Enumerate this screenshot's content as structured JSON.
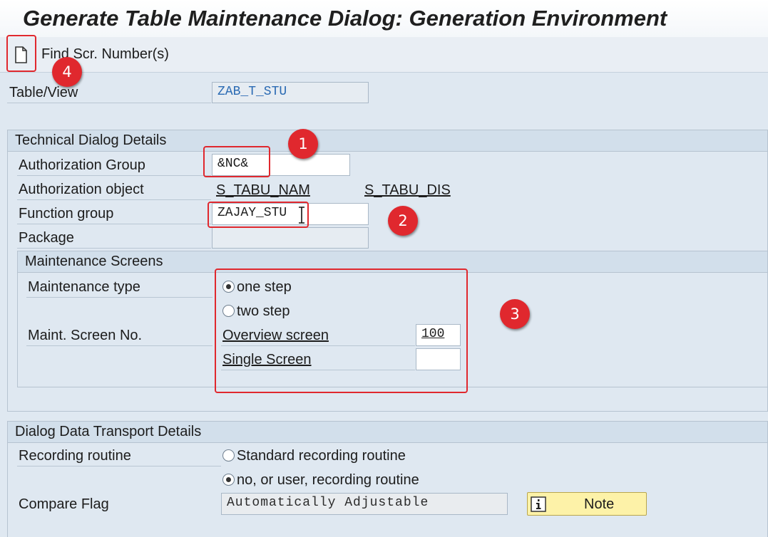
{
  "window": {
    "title": "Generate Table Maintenance Dialog: Generation Environment"
  },
  "toolbar": {
    "find_label": "Find Scr. Number(s)",
    "new_icon": "document-icon"
  },
  "table_view": {
    "label": "Table/View",
    "value": "ZAB_T_STU"
  },
  "technical": {
    "header": "Technical Dialog Details",
    "auth_group_label": "Authorization Group",
    "auth_group_value": "&NC&",
    "auth_object_label": "Authorization object",
    "auth_object_link1": "S_TABU_NAM",
    "auth_object_link2": "S_TABU_DIS",
    "function_group_label": "Function group",
    "function_group_value": "ZAJAY_STU",
    "package_label": "Package",
    "package_value": ""
  },
  "maintenance": {
    "header": "Maintenance Screens",
    "type_label": "Maintenance type",
    "one_step": "one step",
    "two_step": "two step",
    "selected_type": "one step",
    "screen_no_label": "Maint. Screen No.",
    "overview_label": "Overview screen",
    "overview_value": "100",
    "single_label": "Single Screen",
    "single_value": ""
  },
  "transport": {
    "header": "Dialog Data Transport Details",
    "recording_label": "Recording routine",
    "standard_option": "Standard recording routine",
    "user_option": "no, or user, recording routine",
    "selected_option": "no, or user, recording routine",
    "compare_label": "Compare Flag",
    "compare_value": "Automatically Adjustable",
    "note_label": "Note",
    "note_icon": "info-icon"
  },
  "annotations": {
    "badge1": "1",
    "badge2": "2",
    "badge3": "3",
    "badge4": "4"
  },
  "colors": {
    "annotation_red": "#e0282e",
    "accent_blue": "#2a6ab3",
    "note_yellow": "#fdf2a8"
  }
}
